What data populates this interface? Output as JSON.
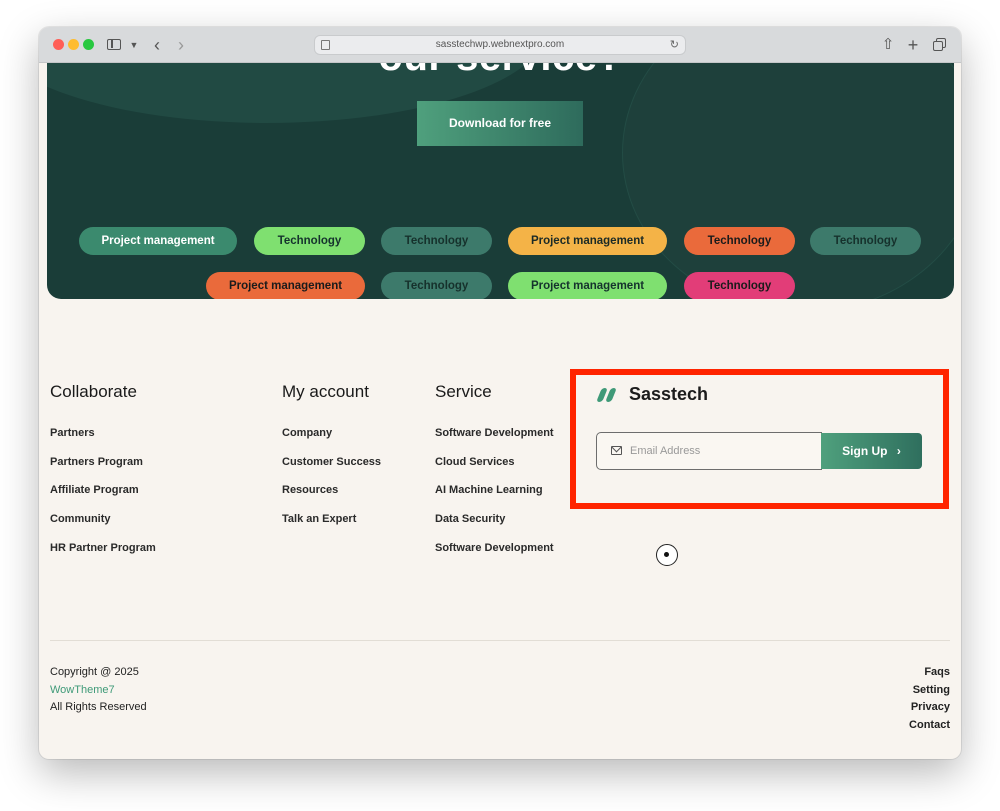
{
  "browser": {
    "url": "sasstechwp.webnextpro.com"
  },
  "hero": {
    "title": "our service?",
    "download_label": "Download for free",
    "tags_row1": [
      "Project management",
      "Technology",
      "Technology",
      "Project management",
      "Technology",
      "Technology"
    ],
    "tags_row2": [
      "Project management",
      "Technology",
      "Project management",
      "Technology"
    ]
  },
  "footer": {
    "columns": [
      {
        "title": "Collaborate",
        "links": [
          "Partners",
          "Partners Program",
          "Affiliate Program",
          "Community",
          "HR Partner Program"
        ]
      },
      {
        "title": "My account",
        "links": [
          "Company",
          "Customer Success",
          "Resources",
          "Talk an Expert"
        ]
      },
      {
        "title": "Service",
        "links": [
          "Software Development",
          "Cloud Services",
          "AI Machine Learning",
          "Data Security",
          "Software Development"
        ]
      }
    ],
    "newsletter": {
      "brand_name": "Sasstech",
      "email_placeholder": "Email Address",
      "signup_label": "Sign Up",
      "signup_chevron": "›"
    },
    "copyright": "Copyright @ 2025",
    "brand_link": "WowTheme7",
    "rights": "All Rights Reserved",
    "bottom_links": [
      "Faqs",
      "Setting",
      "Privacy",
      "Contact"
    ]
  },
  "colors": {
    "hero_bg": "#1a3d38",
    "accent": "#3f9a78",
    "highlight_border": "#ff2400",
    "page_bg": "#f8f4ef"
  }
}
